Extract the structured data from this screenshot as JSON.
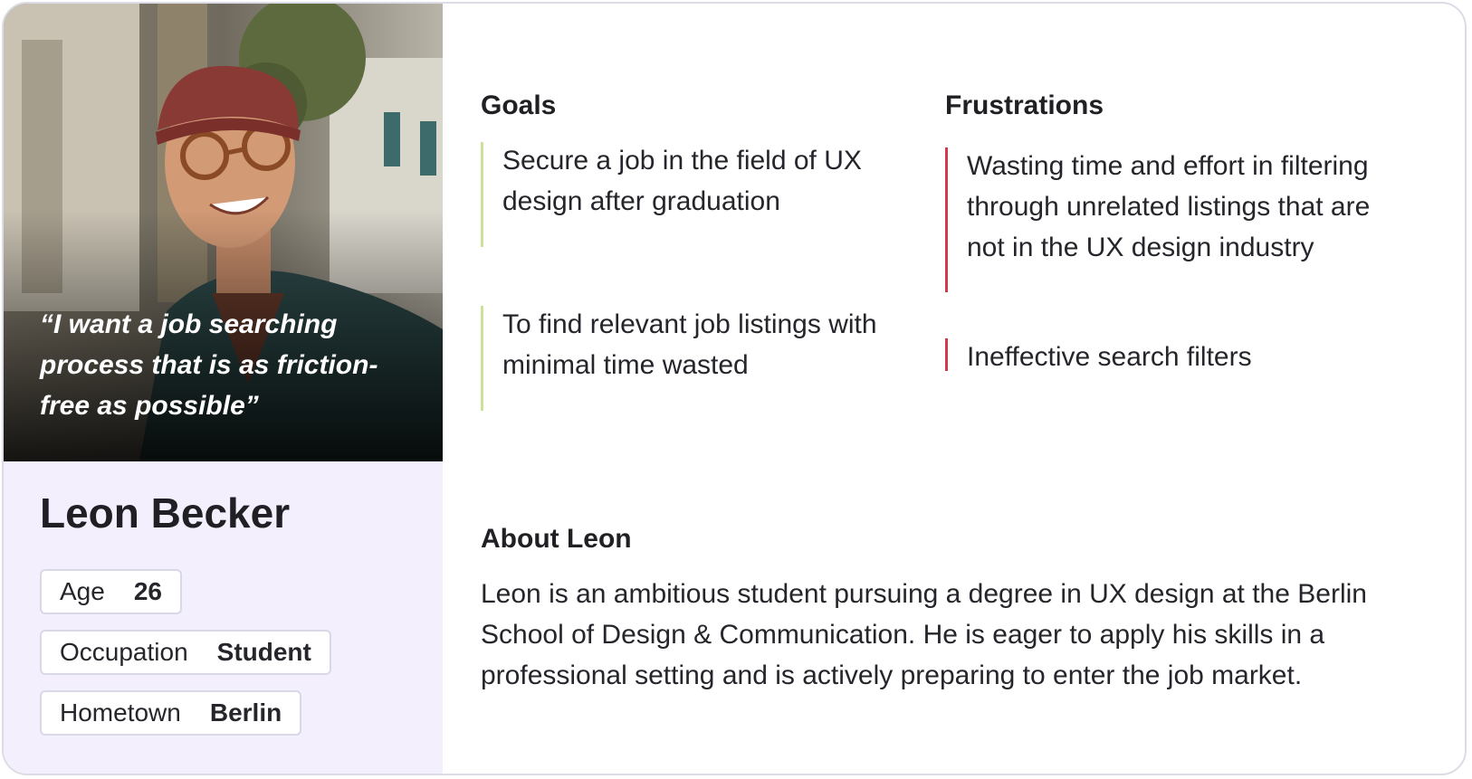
{
  "persona": {
    "quote": "“I want a job searching process that is as friction-free as possible”",
    "name": "Leon Becker",
    "details": {
      "age": {
        "label": "Age",
        "value": "26"
      },
      "occupation": {
        "label": "Occupation",
        "value": "Student"
      },
      "hometown": {
        "label": "Hometown",
        "value": "Berlin"
      }
    }
  },
  "goals": {
    "heading": "Goals",
    "items": [
      "Secure a job in the field of UX design after graduation",
      "To find relevant job listings with minimal time wasted"
    ]
  },
  "frustrations": {
    "heading": "Frustrations",
    "items": [
      "Wasting time and effort in filtering through unrelated listings that are not in the UX design industry",
      "Ineffective search filters"
    ]
  },
  "about": {
    "heading": "About Leon",
    "text": "Leon is an ambitious student pursuing a degree in UX design at the Berlin School of Design & Communication.  He is eager to apply his skills in a professional setting and is actively preparing to enter the job market."
  },
  "colors": {
    "goal_accent": "#c9e39a",
    "frustration_accent": "#d7374a",
    "profile_panel": "#f4effd"
  }
}
